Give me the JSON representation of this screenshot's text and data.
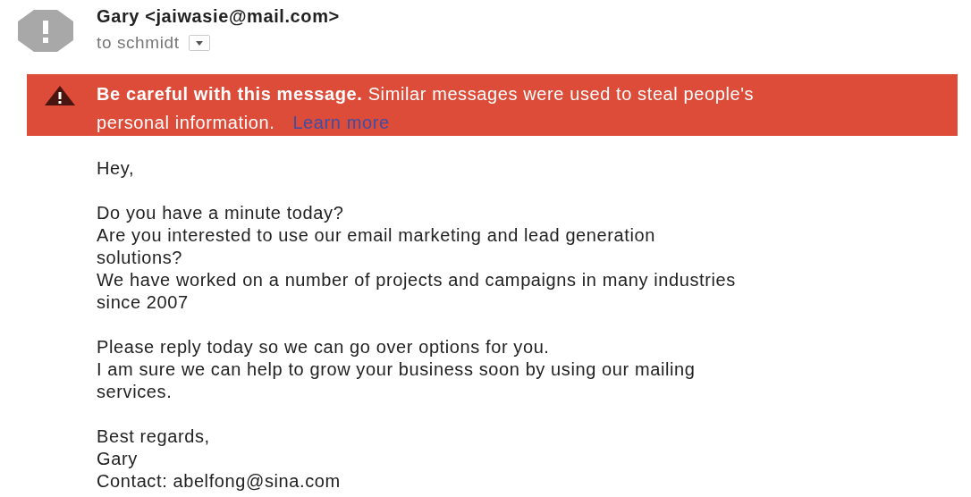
{
  "sender": {
    "name_line": "Gary <jaiwasie@mail.com>",
    "recipient": "to schmidt"
  },
  "warning": {
    "title": "Be careful with this message.",
    "line_1": "Similar messages were used to steal people's",
    "line_2": "personal information.",
    "link": "Learn more"
  },
  "body": [
    [
      "Hey,"
    ],
    [
      "Do you have a minute today?",
      "Are you interested to use our email marketing and lead generation",
      "solutions?",
      "We have worked on a number of projects and campaigns in many industries",
      "since 2007"
    ],
    [
      "Please reply today so we can go over options for you.",
      "I am sure we can help to grow your business soon by using our mailing",
      "services."
    ],
    [
      "Best regards,",
      "Gary",
      "Contact: abelfong@sina.com"
    ]
  ]
}
